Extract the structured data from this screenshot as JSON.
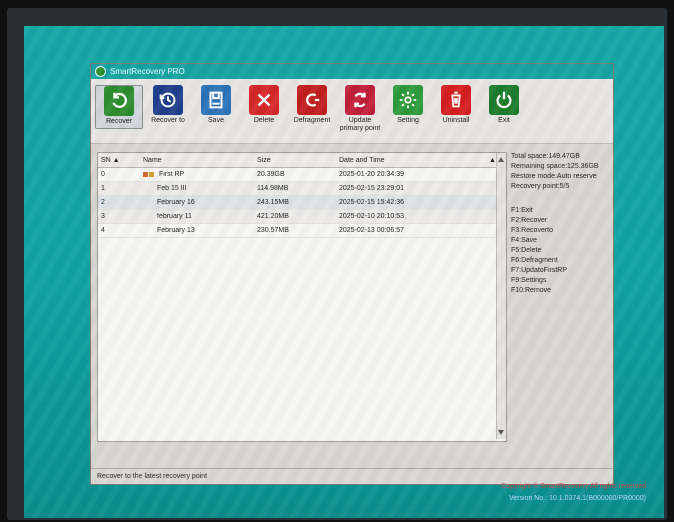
{
  "window": {
    "title": "SmartRecovery PRO"
  },
  "toolbar": {
    "items": [
      {
        "label": "Recover",
        "icon": "recover-icon",
        "color": "#2d8d2d"
      },
      {
        "label": "Recover to",
        "icon": "recover-to-icon",
        "color": "#1f3f8c"
      },
      {
        "label": "Save",
        "icon": "save-icon",
        "color": "#2d73b8"
      },
      {
        "label": "Delete",
        "icon": "delete-icon",
        "color": "#d62828"
      },
      {
        "label": "Defragment",
        "icon": "defragment-icon",
        "color": "#c21f1f"
      },
      {
        "label": "Update primary point",
        "icon": "update-primary-point-icon",
        "color": "#c31f3c"
      },
      {
        "label": "Setting",
        "icon": "gear-icon",
        "color": "#2f9a3a"
      },
      {
        "label": "Uninstall",
        "icon": "trash-icon",
        "color": "#d51f1f"
      },
      {
        "label": "Exit",
        "icon": "exit-icon",
        "color": "#1d7d2b"
      }
    ]
  },
  "table": {
    "headers": {
      "sn": "SN ▲",
      "name": "Name",
      "size": "Size",
      "datetime": "Date and Time"
    },
    "rows": [
      {
        "sn": "0",
        "name": "First RP",
        "size": "20.39GB",
        "datetime": "2025-01-20 20:34:39"
      },
      {
        "sn": "1",
        "name": "Feb 15 III",
        "size": "114.98MB",
        "datetime": "2025-02-15 23:29:01"
      },
      {
        "sn": "2",
        "name": "February 16",
        "size": "243.15MB",
        "datetime": "2025-02-15 15:42:36"
      },
      {
        "sn": "3",
        "name": "february 11",
        "size": "421.20MB",
        "datetime": "2025-02-10 20:10:53"
      },
      {
        "sn": "4",
        "name": "February 13",
        "size": "230.57MB",
        "datetime": "2025-02-13 00:06:57"
      }
    ]
  },
  "info": {
    "total_space": "Total space:149.47GB",
    "remaining_space": "Remaining space:125.36GB",
    "restore_mode": "Restore mode:Auto reserve",
    "recovery_point": "Recovery point:5/5",
    "shortcuts": [
      "F1:Exit",
      "F2:Recover",
      "F3:Recoverto",
      "F4:Save",
      "F5:Delete",
      "F6:Defragment",
      "F7:UpdatoFirstRP",
      "F9:Settings",
      "F10:Remove"
    ]
  },
  "status": {
    "text": "Recover to the latest recovery point"
  },
  "footer": {
    "line1": "Copyright © SmartRecovery All rights reserved",
    "line2": "Version No.: 10.1.0374.1(B000000/PR0000)"
  }
}
